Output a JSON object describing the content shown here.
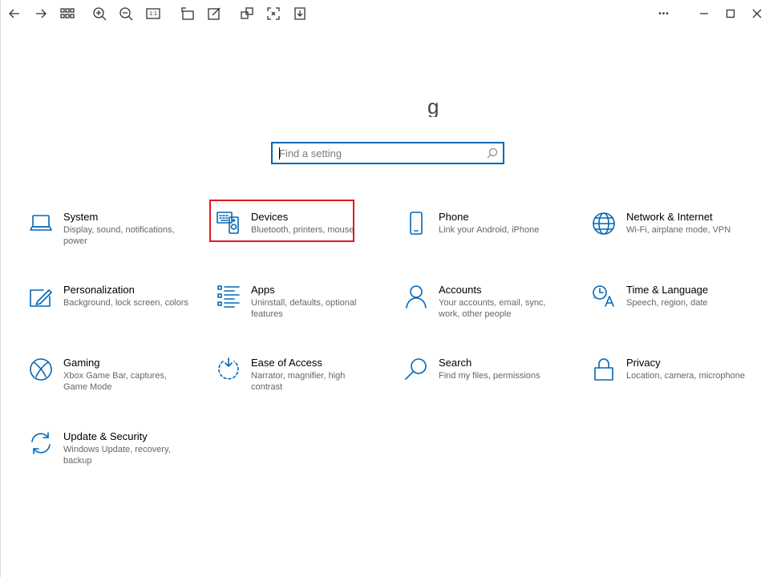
{
  "toolbar": {
    "buttons": [
      {
        "name": "back-icon"
      },
      {
        "name": "forward-icon"
      },
      {
        "name": "grid-view-icon"
      },
      {
        "name": "zoom-in-icon"
      },
      {
        "name": "zoom-out-icon"
      },
      {
        "name": "actual-size-icon",
        "label": "1:1"
      },
      {
        "name": "rotate-icon"
      },
      {
        "name": "edit-icon"
      },
      {
        "name": "extract-icon"
      },
      {
        "name": "crop-icon"
      },
      {
        "name": "download-icon"
      },
      {
        "name": "more-options-icon"
      },
      {
        "name": "minimize-icon"
      },
      {
        "name": "maximize-icon"
      },
      {
        "name": "close-icon"
      }
    ],
    "actual_size_label": "1:1",
    "more_label": "•••"
  },
  "heading_stub": "g",
  "search": {
    "placeholder": "Find a setting",
    "value": ""
  },
  "accent_color": "#0067b8",
  "highlight_color": "#e0181f",
  "tiles": [
    {
      "title": "System",
      "description": "Display, sound, notifications, power",
      "icon": "laptop-icon"
    },
    {
      "title": "Devices",
      "description": "Bluetooth, printers, mouse",
      "icon": "devices-icon",
      "highlighted": true
    },
    {
      "title": "Phone",
      "description": "Link your Android, iPhone",
      "icon": "phone-icon"
    },
    {
      "title": "Network & Internet",
      "description": "Wi-Fi, airplane mode, VPN",
      "icon": "globe-icon"
    },
    {
      "title": "Personalization",
      "description": "Background, lock screen, colors",
      "icon": "paint-icon"
    },
    {
      "title": "Apps",
      "description": "Uninstall, defaults, optional features",
      "icon": "apps-list-icon"
    },
    {
      "title": "Accounts",
      "description": "Your accounts, email, sync, work, other people",
      "icon": "person-icon"
    },
    {
      "title": "Time & Language",
      "description": "Speech, region, date",
      "icon": "time-language-icon"
    },
    {
      "title": "Gaming",
      "description": "Xbox Game Bar, captures, Game Mode",
      "icon": "xbox-icon"
    },
    {
      "title": "Ease of Access",
      "description": "Narrator, magnifier, high contrast",
      "icon": "ease-of-access-icon"
    },
    {
      "title": "Search",
      "description": "Find my files, permissions",
      "icon": "search-icon"
    },
    {
      "title": "Privacy",
      "description": "Location, camera, microphone",
      "icon": "lock-icon"
    },
    {
      "title": "Update & Security",
      "description": "Windows Update, recovery, backup",
      "icon": "refresh-icon"
    }
  ]
}
